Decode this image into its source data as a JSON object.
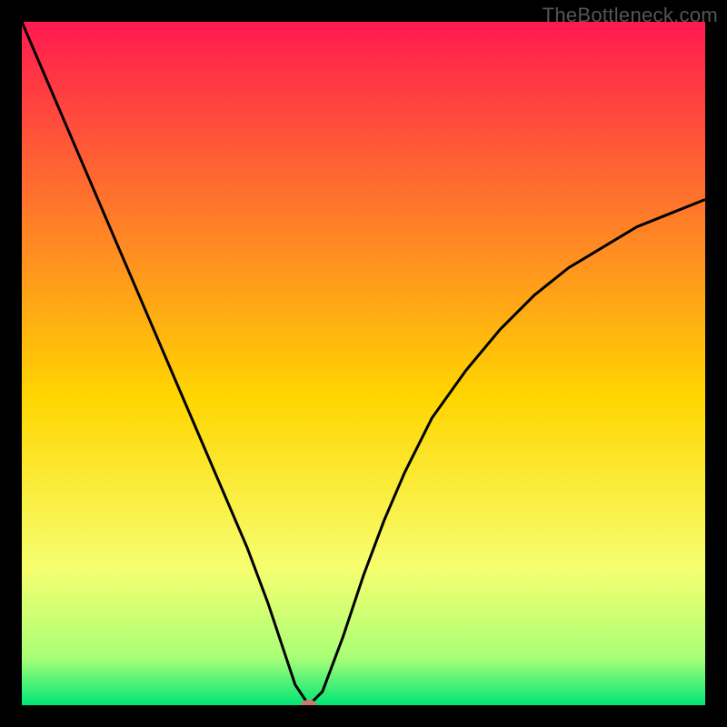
{
  "watermark": "TheBottleneck.com",
  "colors": {
    "frame_bg": "#000000",
    "gradient_top": "#ff1a4f",
    "gradient_q1": "#ff7a2a",
    "gradient_mid": "#ffd600",
    "gradient_q3": "#f6ff70",
    "gradient_near_bottom": "#aaff77",
    "gradient_bottom": "#00e676",
    "curve": "#000000",
    "marker": "#c77a72"
  },
  "chart_data": {
    "type": "line",
    "title": "",
    "xlabel": "",
    "ylabel": "",
    "xlim": [
      0,
      1
    ],
    "ylim": [
      0,
      1
    ],
    "marker": {
      "x": 0.42,
      "y": 0.0
    },
    "series": [
      {
        "name": "curve",
        "x": [
          0.0,
          0.03,
          0.06,
          0.09,
          0.12,
          0.15,
          0.18,
          0.21,
          0.24,
          0.27,
          0.3,
          0.33,
          0.36,
          0.38,
          0.4,
          0.42,
          0.44,
          0.47,
          0.5,
          0.53,
          0.56,
          0.6,
          0.65,
          0.7,
          0.75,
          0.8,
          0.85,
          0.9,
          0.95,
          1.0
        ],
        "y": [
          1.0,
          0.93,
          0.86,
          0.79,
          0.72,
          0.65,
          0.58,
          0.51,
          0.44,
          0.37,
          0.3,
          0.23,
          0.15,
          0.09,
          0.03,
          0.0,
          0.02,
          0.1,
          0.19,
          0.27,
          0.34,
          0.42,
          0.49,
          0.55,
          0.6,
          0.64,
          0.67,
          0.7,
          0.72,
          0.74
        ]
      }
    ]
  }
}
